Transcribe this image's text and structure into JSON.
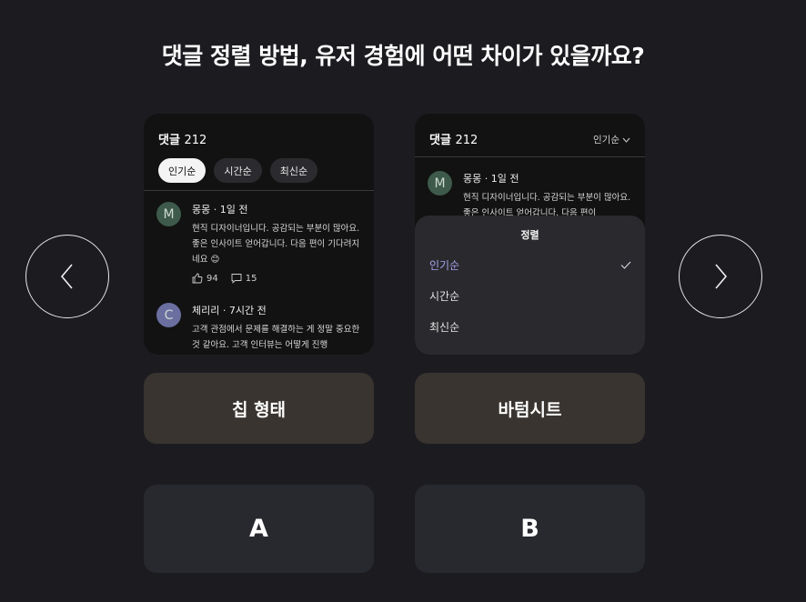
{
  "title": "댓글 정렬 방법, 유저 경험에 어떤 차이가 있을까요?",
  "option_a": {
    "header_label": "댓글",
    "header_count": "212",
    "chips": [
      "인기순",
      "시간순",
      "최신순"
    ],
    "comments": [
      {
        "avatar": "M",
        "avatar_color": "#3d5a4a",
        "meta": "몽몽 · 1일 전",
        "text": "현직 디자이너입니다. 공감되는 부분이 많아요. 좋은 인사이트 얻어갑니다. 다음 편이 기다려지네요 😊",
        "likes": "94",
        "replies": "15"
      },
      {
        "avatar": "C",
        "avatar_color": "#6a6fa0",
        "meta": "체리리 · 7시간 전",
        "text": "고객 관점에서 문제를 해결하는 게 정말 중요한 것 같아요. 고객 인터뷰는 어떻게 진행"
      }
    ],
    "label": "칩 형태",
    "vote": "A"
  },
  "option_b": {
    "header_label": "댓글",
    "header_count": "212",
    "sort_current": "인기순",
    "comment": {
      "avatar": "M",
      "avatar_color": "#3d5a4a",
      "meta": "몽몽 · 1일 전",
      "text": "현직 디자이너입니다. 공감되는 부분이 많아요. 좋은 인사이트 얻어갑니다. 다음 편이"
    },
    "sheet_title": "정렬",
    "options": [
      "인기순",
      "시간순",
      "최신순"
    ],
    "label": "바텀시트",
    "vote": "B"
  },
  "colors": {
    "background": "#1c1c20",
    "selected_option": "#a6a3ee",
    "label_box": "#393430",
    "vote_box": "#28292e"
  },
  "icons": [
    "chevron-left-icon",
    "chevron-right-icon",
    "thumbs-up-icon",
    "comment-icon",
    "chevron-down-icon",
    "check-icon"
  ]
}
